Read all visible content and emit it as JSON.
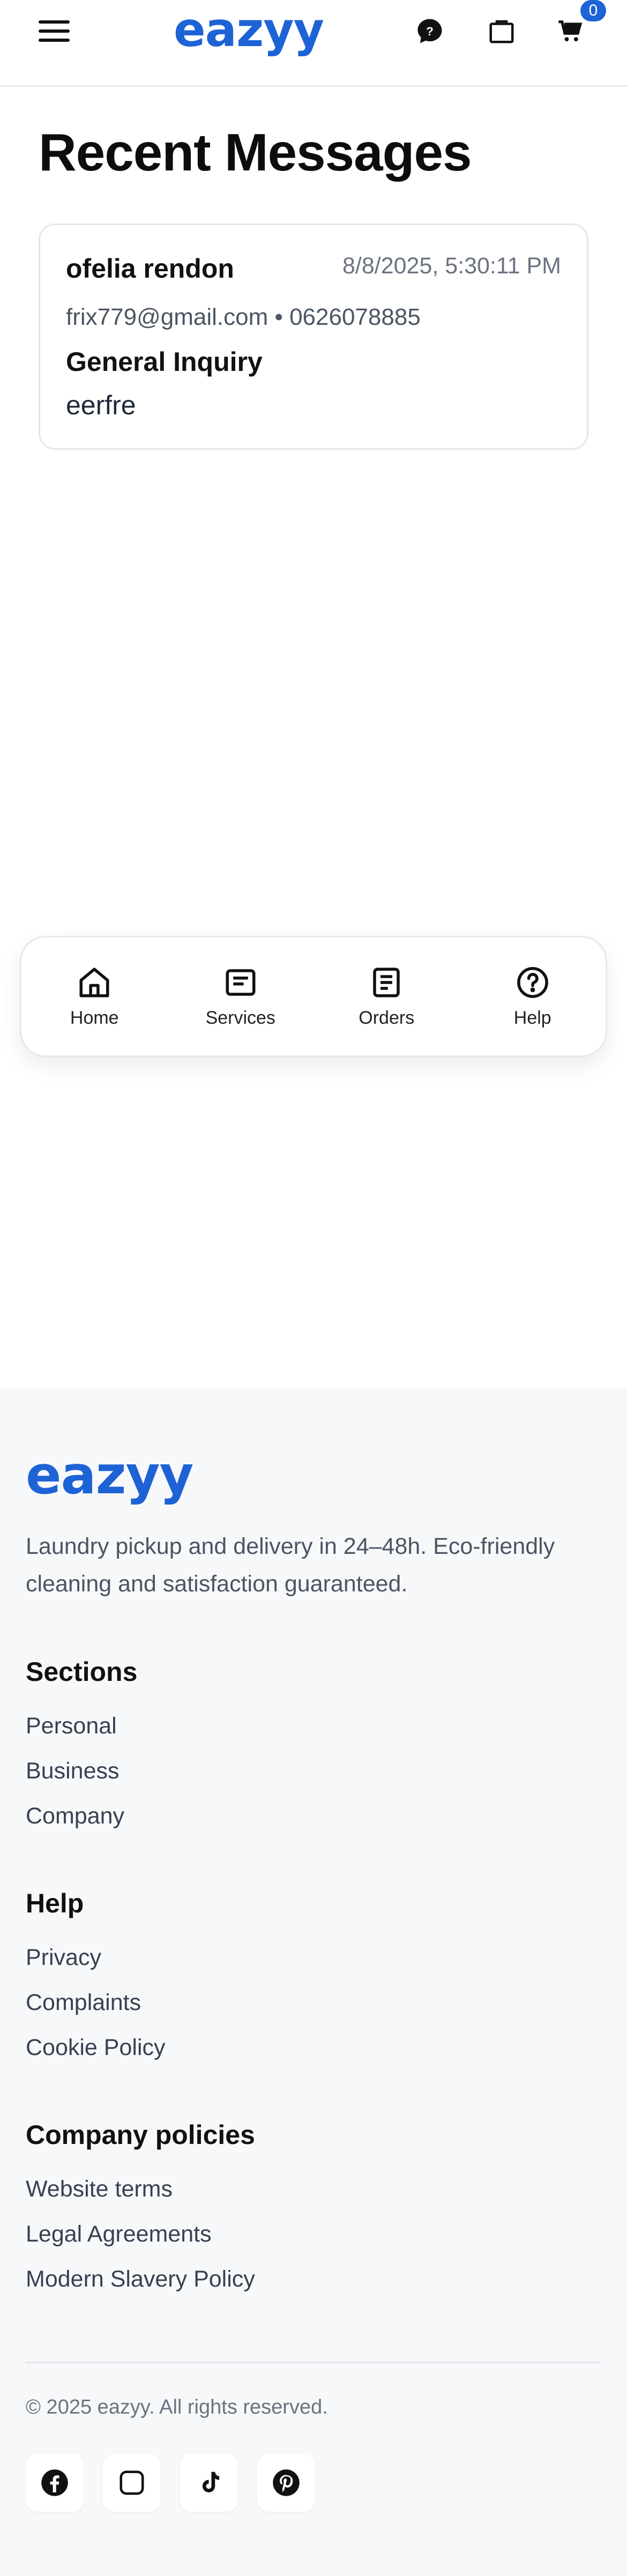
{
  "header": {
    "logo": "eazyy",
    "cart_count": "0",
    "icons": [
      "menu-icon",
      "help-chat-icon",
      "bag-icon",
      "cart-icon"
    ]
  },
  "main": {
    "title": "Recent Messages",
    "messages": [
      {
        "name": "ofelia rendon",
        "date": "8/8/2025, 5:30:11 PM",
        "contact": "frix779@gmail.com • 0626078885",
        "subject": "General Inquiry",
        "body": "eerfre"
      }
    ]
  },
  "bottom_nav": {
    "items": [
      {
        "label": "Home",
        "icon": "home-icon"
      },
      {
        "label": "Services",
        "icon": "services-icon"
      },
      {
        "label": "Orders",
        "icon": "orders-icon"
      },
      {
        "label": "Help",
        "icon": "help-icon"
      }
    ]
  },
  "footer": {
    "logo": "eazyy",
    "tagline": "Laundry pickup and delivery in 24–48h. Eco-friendly cleaning and satisfaction guaranteed.",
    "sections": [
      {
        "heading": "Sections",
        "links": [
          "Personal",
          "Business",
          "Company"
        ]
      },
      {
        "heading": "Help",
        "links": [
          "Privacy",
          "Complaints",
          "Cookie Policy"
        ]
      },
      {
        "heading": "Company policies",
        "links": [
          "Website terms",
          "Legal Agreements",
          "Modern Slavery Policy"
        ]
      }
    ],
    "copyright": "© 2025 eazyy. All rights reserved.",
    "social": [
      "facebook-icon",
      "instagram-icon",
      "tiktok-icon",
      "pinterest-icon"
    ]
  },
  "colors": {
    "brand": "#1d63d6",
    "footer_bg": "#f7f8fa"
  }
}
